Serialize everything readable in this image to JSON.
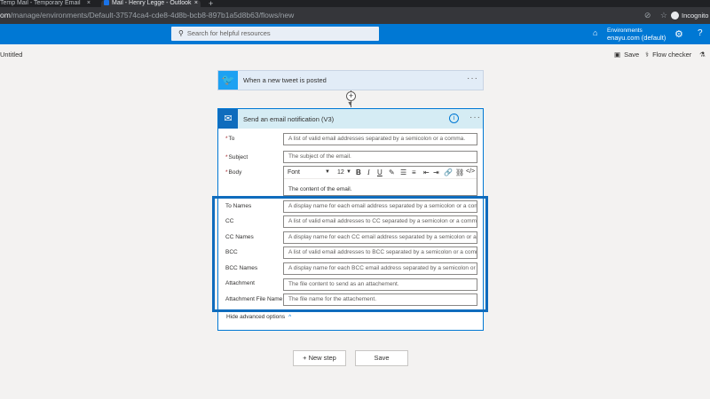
{
  "browser": {
    "tab1_title": "Temp Mail - Temporary Email",
    "tab2_title": "Mail - Henry Legge - Outlook",
    "url_host": "om",
    "url_path": "/manage/environments/Default-37574ca4-cde8-4d8b-bcb8-897b1a5d8b63/flows/new",
    "profile_label": "Incognito"
  },
  "appbar": {
    "search_placeholder": "Search for helpful resources",
    "env_label": "Environments",
    "env_name": "enayu.com (default)"
  },
  "cmdbar": {
    "title": "Untitled",
    "save_label": "Save",
    "checker_label": "Flow checker"
  },
  "trigger": {
    "title": "When a new tweet is posted"
  },
  "action": {
    "title": "Send an email notification (V3)",
    "fields": {
      "to": {
        "label": "To",
        "placeholder": "A list of valid email addresses separated by a semicolon or a comma."
      },
      "subject": {
        "label": "Subject",
        "placeholder": "The subject of the email."
      },
      "body": {
        "label": "Body",
        "font": "Font",
        "size": "12",
        "placeholder": "The content of the email."
      },
      "to_names": {
        "label": "To Names",
        "placeholder": "A display name for each email address separated by a semicolon or a comma."
      },
      "cc": {
        "label": "CC",
        "placeholder": "A list of valid email addresses to CC separated by a semicolon or a comma."
      },
      "cc_names": {
        "label": "CC Names",
        "placeholder": "A display name for each CC email address separated by a semicolon or a comma."
      },
      "bcc": {
        "label": "BCC",
        "placeholder": "A list of valid email addresses to BCC separated by a semicolon or a comma."
      },
      "bcc_names": {
        "label": "BCC Names",
        "placeholder": "A display name for each BCC email address separated by a semicolon or a comma."
      },
      "attachment": {
        "label": "Attachment",
        "placeholder": "The file content to send as an attachement."
      },
      "attachment_file_name": {
        "label": "Attachment File Name",
        "placeholder": "The file name for the attachement."
      }
    },
    "toggle_advanced": "Hide advanced options"
  },
  "footer": {
    "new_step_label": "+ New step",
    "save_label": "Save"
  },
  "colors": {
    "accent": "#0078d4",
    "highlight": "#0f6cbd",
    "twitter": "#1da1f2"
  }
}
